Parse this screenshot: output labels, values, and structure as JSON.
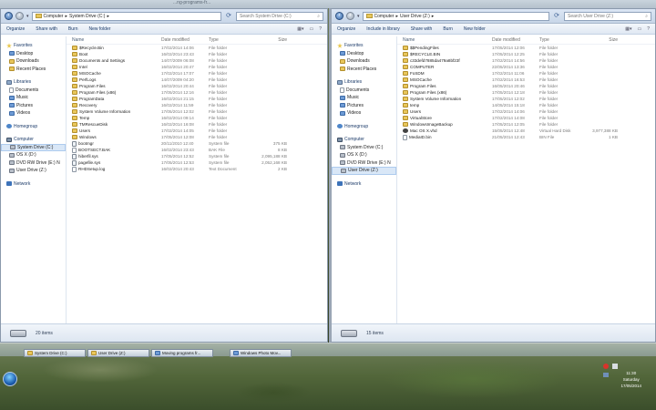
{
  "left": {
    "title_fragment": "...",
    "breadcrumb": [
      "Computer",
      "System Drive (C:)"
    ],
    "search_placeholder": "Search System Drive (C:)",
    "toolbar": [
      "Organize",
      "Share with",
      "Burn",
      "New folder"
    ],
    "columns": [
      "Name",
      "Date modified",
      "Type",
      "Size"
    ],
    "nav": {
      "favorites": [
        "Favorites",
        "Desktop",
        "Downloads",
        "Recent Places"
      ],
      "libraries": [
        "Libraries",
        "Documents",
        "Music",
        "Pictures",
        "Videos"
      ],
      "homegroup": "Homegroup",
      "computer": [
        "Computer",
        "System Drive (C:)",
        "OS X (D:)",
        "DVD RW Drive (E:) N",
        "User Drive (Z:)"
      ],
      "network": "Network"
    },
    "rows": [
      {
        "icon": "folder",
        "name": "$Recycle.Bin",
        "date": "17/02/2014 14:06",
        "type": "File folder",
        "size": ""
      },
      {
        "icon": "folder",
        "name": "Boot",
        "date": "16/02/2014 23:43",
        "type": "File folder",
        "size": ""
      },
      {
        "icon": "folder",
        "name": "Documents and Settings",
        "date": "14/07/2009 06:08",
        "type": "File folder",
        "size": ""
      },
      {
        "icon": "folder",
        "name": "Intel",
        "date": "16/02/2014 20:47",
        "type": "File folder",
        "size": ""
      },
      {
        "icon": "folder",
        "name": "MSOCache",
        "date": "17/02/2014 17:07",
        "type": "File folder",
        "size": ""
      },
      {
        "icon": "folder",
        "name": "PerfLogs",
        "date": "14/07/2009 04:20",
        "type": "File folder",
        "size": ""
      },
      {
        "icon": "folder",
        "name": "Program Files",
        "date": "16/02/2014 20:44",
        "type": "File folder",
        "size": ""
      },
      {
        "icon": "folder",
        "name": "Program Files (x86)",
        "date": "17/05/2014 12:16",
        "type": "File folder",
        "size": ""
      },
      {
        "icon": "folder",
        "name": "ProgramData",
        "date": "16/02/2014 21:15",
        "type": "File folder",
        "size": ""
      },
      {
        "icon": "folder",
        "name": "Recovery",
        "date": "16/02/2014 11:59",
        "type": "File folder",
        "size": ""
      },
      {
        "icon": "folder",
        "name": "System Volume Information",
        "date": "17/05/2014 12:02",
        "type": "File folder",
        "size": ""
      },
      {
        "icon": "folder",
        "name": "Temp",
        "date": "16/02/2014 09:14",
        "type": "File folder",
        "size": ""
      },
      {
        "icon": "folder",
        "name": "TMRescueDisk",
        "date": "16/02/2014 16:08",
        "type": "File folder",
        "size": ""
      },
      {
        "icon": "folder",
        "name": "Users",
        "date": "17/02/2014 14:05",
        "type": "File folder",
        "size": ""
      },
      {
        "icon": "folder",
        "name": "Windows",
        "date": "17/05/2014 12:08",
        "type": "File folder",
        "size": ""
      },
      {
        "icon": "sys",
        "name": "bootmgr",
        "date": "20/11/2010 12:40",
        "type": "System file",
        "size": "375 KB"
      },
      {
        "icon": "file",
        "name": "BOOTSECT.BAK",
        "date": "16/02/2014 23:43",
        "type": "BAK File",
        "size": "8 KB"
      },
      {
        "icon": "sys",
        "name": "hiberfil.sys",
        "date": "17/05/2014 12:52",
        "type": "System file",
        "size": "2,095,188 KB"
      },
      {
        "icon": "sys",
        "name": "pagefile.sys",
        "date": "17/05/2014 12:53",
        "type": "System file",
        "size": "2,052,168 KB"
      },
      {
        "icon": "file",
        "name": "RHDSetup.log",
        "date": "16/02/2014 20:43",
        "type": "Text Document",
        "size": "2 KB"
      }
    ],
    "status": "20 items"
  },
  "right": {
    "breadcrumb": [
      "Computer",
      "User Drive (Z:)"
    ],
    "search_placeholder": "Search User Drive (Z:)",
    "toolbar": [
      "Organize",
      "Include in library",
      "Share with",
      "Burn",
      "New folder"
    ],
    "columns": [
      "Name",
      "Date modified",
      "Type",
      "Size"
    ],
    "nav": {
      "favorites": [
        "Favorites",
        "Desktop",
        "Downloads",
        "Recent Places"
      ],
      "libraries": [
        "Libraries",
        "Documents",
        "Music",
        "Pictures",
        "Videos"
      ],
      "homegroup": "Homegroup",
      "computer": [
        "Computer",
        "System Drive (C:)",
        "OS X (D:)",
        "DVD RW Drive (E:) N",
        "User Drive (Z:)"
      ],
      "network": "Network"
    },
    "rows": [
      {
        "icon": "folder",
        "name": "$$PendingFiles",
        "date": "17/05/2014 12:06",
        "type": "File folder",
        "size": ""
      },
      {
        "icon": "folder",
        "name": "$RECYCLE.BIN",
        "date": "17/05/2014 12:25",
        "type": "File folder",
        "size": ""
      },
      {
        "icon": "folder",
        "name": "c33defd7885da479a8bf23f",
        "date": "17/02/2014 14:56",
        "type": "File folder",
        "size": ""
      },
      {
        "icon": "folder",
        "name": "COMPUTER",
        "date": "22/05/2014 13:36",
        "type": "File folder",
        "size": ""
      },
      {
        "icon": "folder",
        "name": "FoSDM",
        "date": "17/02/2014 11:06",
        "type": "File folder",
        "size": ""
      },
      {
        "icon": "folder",
        "name": "MSOCache",
        "date": "17/02/2014 16:53",
        "type": "File folder",
        "size": ""
      },
      {
        "icon": "folder",
        "name": "Program Files",
        "date": "16/05/2014 20:46",
        "type": "File folder",
        "size": ""
      },
      {
        "icon": "folder",
        "name": "Program Files (x86)",
        "date": "17/05/2014 12:18",
        "type": "File folder",
        "size": ""
      },
      {
        "icon": "folder",
        "name": "System Volume Information",
        "date": "17/05/2014 12:02",
        "type": "File folder",
        "size": ""
      },
      {
        "icon": "folder",
        "name": "temp",
        "date": "14/05/2014 15:18",
        "type": "File folder",
        "size": ""
      },
      {
        "icon": "folder",
        "name": "Users",
        "date": "17/02/2014 14:06",
        "type": "File folder",
        "size": ""
      },
      {
        "icon": "folder",
        "name": "VirtualStore",
        "date": "17/02/2014 14:08",
        "type": "File folder",
        "size": ""
      },
      {
        "icon": "folder",
        "name": "WindowsImageBackup",
        "date": "17/05/2014 12:05",
        "type": "File folder",
        "size": ""
      },
      {
        "icon": "iso",
        "name": "Mac OS X.vhd",
        "date": "15/05/2014 12:48",
        "type": "Virtual Hard Disk",
        "size": "3,977,388 KB"
      },
      {
        "icon": "file",
        "name": "MediaID.bin",
        "date": "21/05/2014 12:43",
        "type": "BIN File",
        "size": "1 KB"
      }
    ],
    "status": "15 items"
  },
  "taskbar": {
    "buttons": [
      "System Drive (C:)",
      "User Drive (Z:)",
      "Moving programs fr...",
      "Windows Photo Mov..."
    ],
    "clock_time": "11:30",
    "clock_day": "Saturday",
    "clock_date": "17/05/2014"
  },
  "top_fragment": "...ng-programs-fr..."
}
